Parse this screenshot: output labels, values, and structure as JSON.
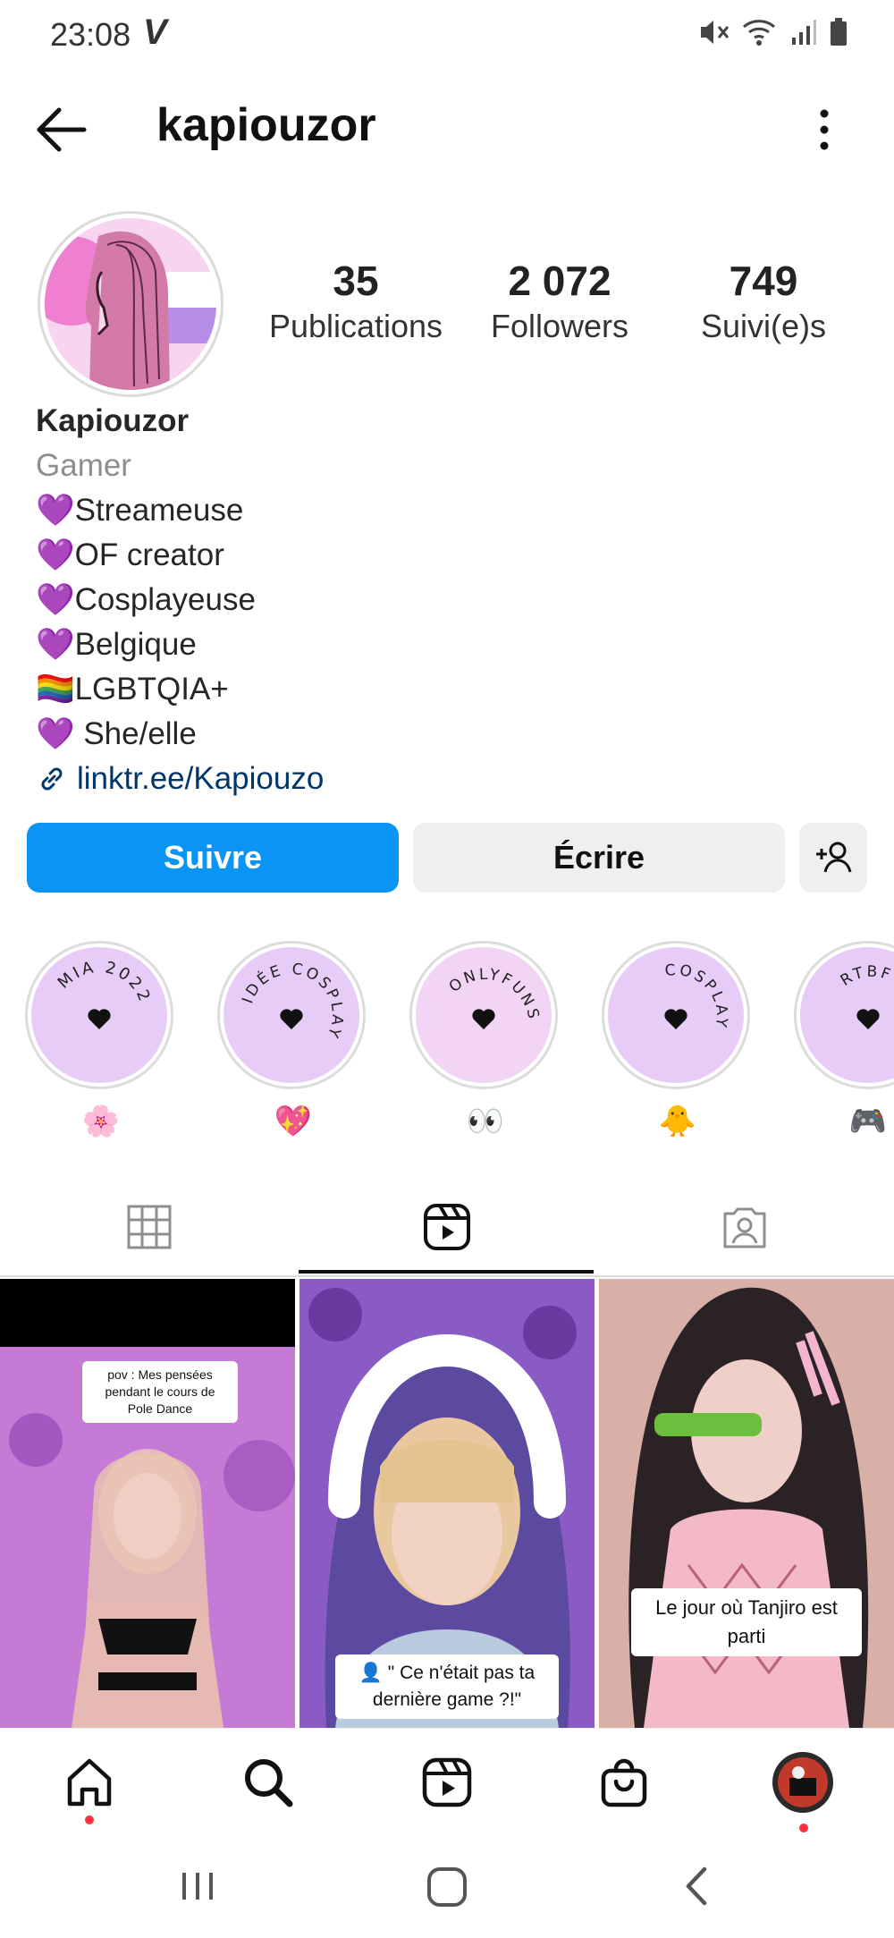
{
  "status_bar": {
    "time": "23:08",
    "carrier_logo": "V"
  },
  "header": {
    "username": "kapiouzor"
  },
  "stats": [
    {
      "value": "35",
      "label": "Publications"
    },
    {
      "value": "2 072",
      "label": "Followers"
    },
    {
      "value": "749",
      "label": "Suivi(e)s"
    }
  ],
  "bio": {
    "name": "Kapiouzor",
    "category": "Gamer",
    "lines": [
      {
        "emoji": "💜",
        "text": "Streameuse"
      },
      {
        "emoji": "💜",
        "text": "OF creator"
      },
      {
        "emoji": "💜",
        "text": "Cosplayeuse"
      },
      {
        "emoji": "💜",
        "text": "Belgique"
      },
      {
        "emoji": "🏳️‍🌈",
        "text": "LGBTQIA+"
      },
      {
        "emoji": "💜",
        "text": " She/elle"
      }
    ],
    "link": "linktr.ee/Kapiouzo"
  },
  "actions": {
    "follow": "Suivre",
    "message": "Écrire"
  },
  "highlights": [
    {
      "title": "MIA 2022",
      "emoji": "🌸"
    },
    {
      "title": "IDÉE COSPLAY",
      "emoji": "💖"
    },
    {
      "title": "ONLYFUNS",
      "emoji": "👀"
    },
    {
      "title": "COSPLAY",
      "emoji": "🐥"
    },
    {
      "title": "RTBF",
      "emoji": "🎮"
    }
  ],
  "grid": [
    {
      "caption": "pov : Mes pensées pendant le cours de Pole Dance"
    },
    {
      "caption": "👤 \" Ce n'était pas ta dernière game ?!\""
    },
    {
      "caption": "Le jour où Tanjiro est parti"
    }
  ],
  "colors": {
    "follow_blue": "#0a95f6",
    "highlight_lilac": "#e6ccf7",
    "notify_red": "#ff3040",
    "link_blue": "#00376b"
  }
}
